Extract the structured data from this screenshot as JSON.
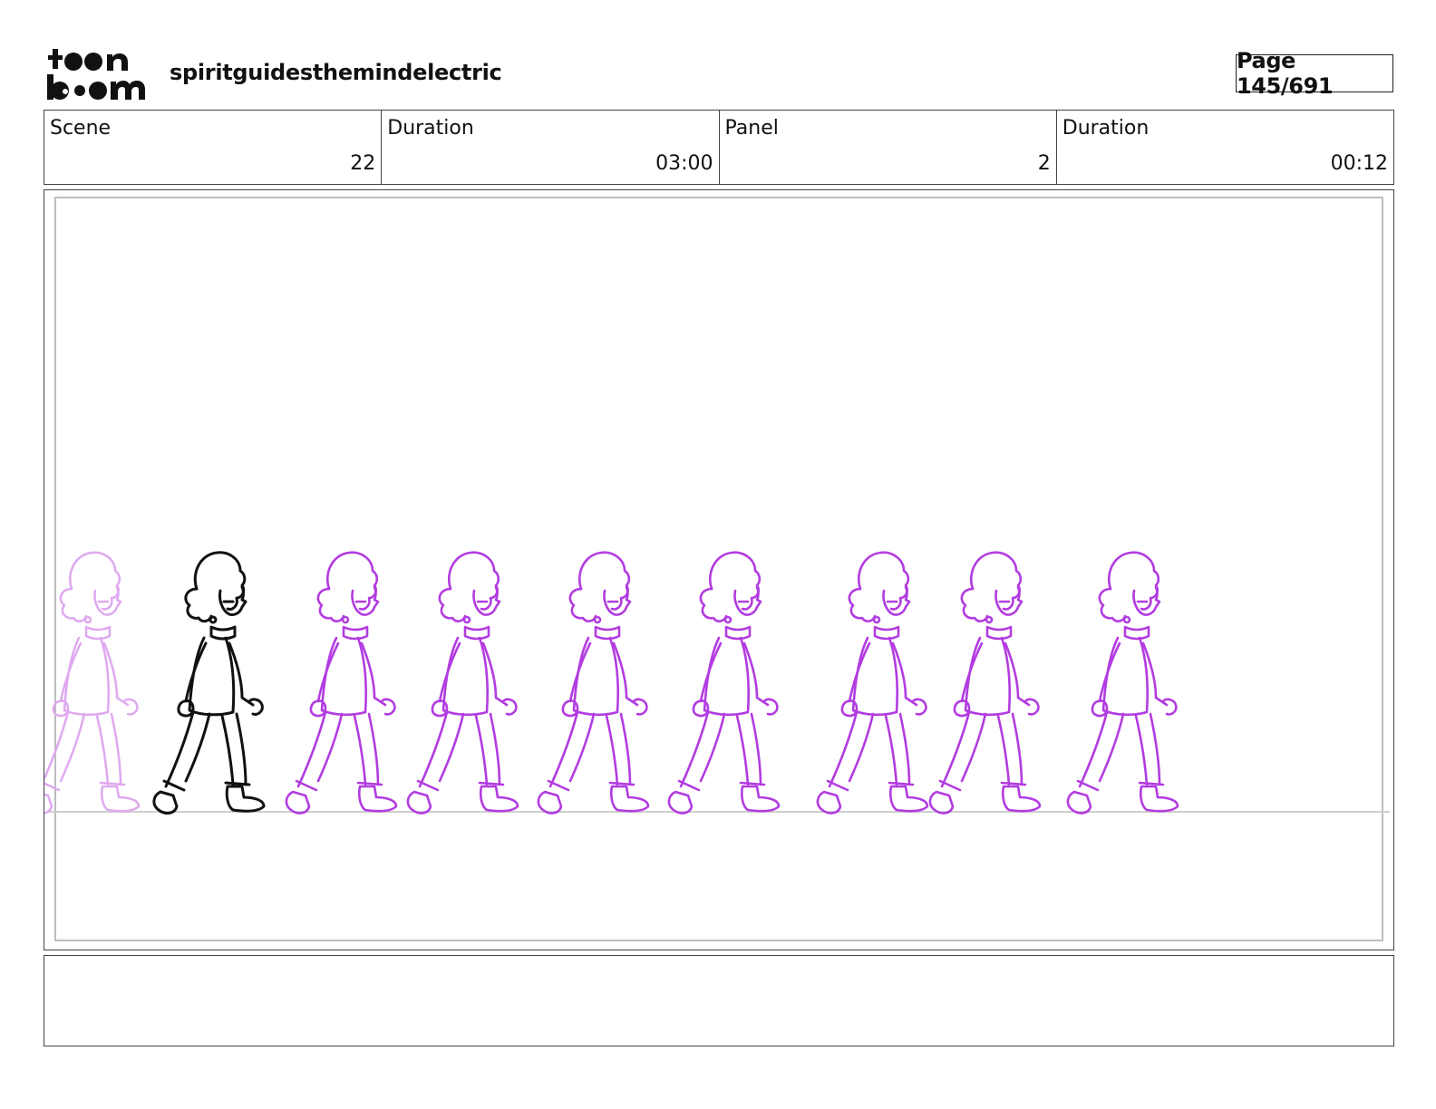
{
  "header": {
    "logo_text": "toon boom",
    "project_title": "spiritguidesthemindelectric",
    "page_label": "Page 145/691"
  },
  "info": {
    "scene_label": "Scene",
    "scene_value": "22",
    "scene_duration_label": "Duration",
    "scene_duration_value": "03:00",
    "panel_label": "Panel",
    "panel_value": "2",
    "panel_duration_label": "Duration",
    "panel_duration_value": "00:12"
  },
  "panel": {
    "walk_cycle_frames": 10,
    "colors": {
      "key_pose": "#111111",
      "onion_skin": "#b23ce0",
      "faded_onion_skin": "#dfa9f0",
      "ground_line": "#cfcfcf",
      "safe_frame": "#bdbdbd"
    }
  },
  "notes": {
    "text": ""
  }
}
